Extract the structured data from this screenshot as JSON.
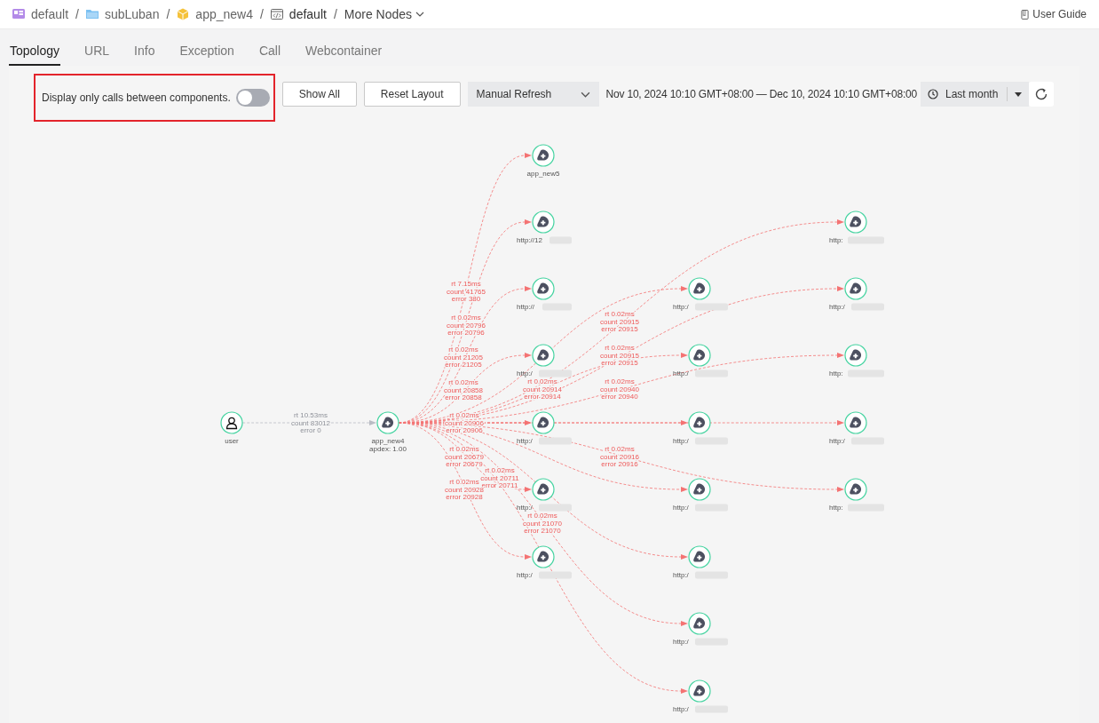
{
  "breadcrumb": [
    {
      "label": "default",
      "kind": "workspace",
      "separator": "/"
    },
    {
      "label": "subLuban",
      "kind": "folder",
      "separator": "/"
    },
    {
      "label": "app_new4",
      "kind": "app",
      "separator": "/"
    },
    {
      "label": "default",
      "kind": "environment",
      "separator": "/"
    }
  ],
  "more_nodes": "More Nodes",
  "user_guide": "User Guide",
  "tabs": [
    {
      "label": "Topology",
      "selected": true
    },
    {
      "label": "URL",
      "selected": false
    },
    {
      "label": "Info",
      "selected": false
    },
    {
      "label": "Exception",
      "selected": false
    },
    {
      "label": "Call",
      "selected": false
    },
    {
      "label": "Webcontainer",
      "selected": false
    }
  ],
  "toolbar": {
    "toggle_label": "Display only calls between components.",
    "toggle_on": false,
    "buttons": [
      "Show All",
      "Reset Layout"
    ],
    "refresh_mode": "Manual Refresh",
    "time_range": "Nov 10, 2024 10:10 GMT+08:00 — Dec 10, 2024 10:10 GMT+08:00",
    "period": "Last month"
  },
  "nodes": [
    {
      "kind": "user",
      "label": [
        "user"
      ],
      "redacted": false
    },
    {
      "kind": "service",
      "label": [
        "app_new4",
        "apdex: 1.00"
      ],
      "redacted": false
    },
    {
      "kind": "service",
      "label": [
        "app_new5"
      ],
      "redacted": false
    },
    {
      "kind": "service",
      "label": [
        "http://12"
      ],
      "redacted": true
    },
    {
      "kind": "service",
      "label": [
        "http://"
      ],
      "redacted": true
    },
    {
      "kind": "service",
      "label": [
        "http:/"
      ],
      "redacted": true
    },
    {
      "kind": "service",
      "label": [
        "http:/"
      ],
      "redacted": true
    },
    {
      "kind": "service",
      "label": [
        "http:/"
      ],
      "redacted": true
    },
    {
      "kind": "service",
      "label": [
        "http:/"
      ],
      "redacted": true
    },
    {
      "kind": "service",
      "label": [
        "http:/"
      ],
      "redacted": true
    },
    {
      "kind": "service",
      "label": [
        "http:/"
      ],
      "redacted": true
    },
    {
      "kind": "service",
      "label": [
        "http:/"
      ],
      "redacted": true
    },
    {
      "kind": "service",
      "label": [
        "http:/"
      ],
      "redacted": true
    },
    {
      "kind": "service",
      "label": [
        "http:/"
      ],
      "redacted": true
    },
    {
      "kind": "service",
      "label": [
        "http:/"
      ],
      "redacted": true
    },
    {
      "kind": "service",
      "label": [
        "http:/"
      ],
      "redacted": true
    },
    {
      "kind": "service",
      "label": [
        "http:"
      ],
      "redacted": true
    },
    {
      "kind": "service",
      "label": [
        "http:/"
      ],
      "redacted": true
    },
    {
      "kind": "service",
      "label": [
        "http:"
      ],
      "redacted": true
    },
    {
      "kind": "service",
      "label": [
        "http:/"
      ],
      "redacted": true
    },
    {
      "kind": "service",
      "label": [
        "http:"
      ],
      "redacted": true
    }
  ],
  "edges": [
    {
      "kind": "normal",
      "label": [
        "rt 10.53ms",
        "count 83012",
        "error 0"
      ]
    },
    {
      "kind": "error",
      "label": [
        "rt 7.15ms",
        "count 41765",
        "error 380"
      ]
    },
    {
      "kind": "error",
      "label": [
        "rt 0.02ms",
        "count 20796",
        "error 20796"
      ]
    },
    {
      "kind": "error",
      "label": [
        "rt 0.02ms",
        "count 21205",
        "error 21205"
      ]
    },
    {
      "kind": "error",
      "label": [
        "rt 0.02ms",
        "count 20858",
        "error 20858"
      ]
    },
    {
      "kind": "error",
      "label": [
        "rt 0.02ms",
        "count 20914",
        "error 20914"
      ]
    },
    {
      "kind": "error",
      "label": [
        "rt 0.02ms",
        "count 20906",
        "error 20906"
      ]
    },
    {
      "kind": "error",
      "label": [
        "rt 0.02ms",
        "count 20679",
        "error 20679"
      ]
    },
    {
      "kind": "error",
      "label": [
        "rt 0.02ms",
        "count 20711",
        "error 20711"
      ]
    },
    {
      "kind": "error",
      "label": [
        "rt 0.02ms",
        "count 20928",
        "error 20928"
      ]
    },
    {
      "kind": "error",
      "label": [
        "rt 0.02ms",
        "count 21070",
        "error 21070"
      ]
    },
    {
      "kind": "error",
      "label": [
        "rt 0.02ms",
        "count 20915",
        "error 20915"
      ]
    },
    {
      "kind": "error",
      "label": [
        "rt 0.02ms",
        "count 20915",
        "error 20915"
      ]
    },
    {
      "kind": "error",
      "label": [
        "rt 0.02ms",
        "count 20940",
        "error 20940"
      ]
    },
    {
      "kind": "error",
      "label": [
        "rt 0.02ms",
        "count 20916",
        "error 20916"
      ]
    },
    {
      "kind": "error"
    },
    {
      "kind": "error"
    },
    {
      "kind": "error"
    },
    {
      "kind": "error"
    },
    {
      "kind": "error"
    }
  ]
}
